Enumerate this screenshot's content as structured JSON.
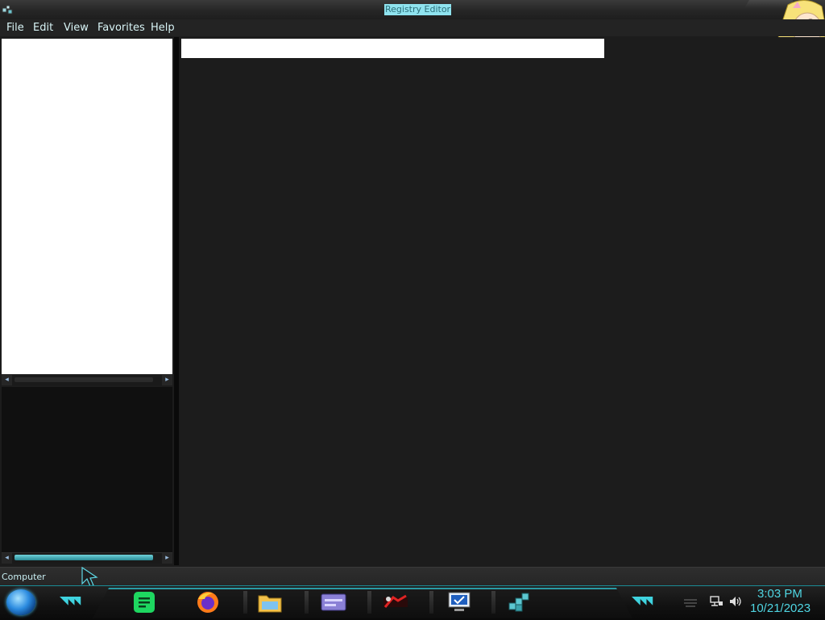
{
  "window": {
    "title": "Registry Editor"
  },
  "menu": {
    "items": [
      {
        "label": "File"
      },
      {
        "label": "Edit"
      },
      {
        "label": "View"
      },
      {
        "label": "Favorites"
      },
      {
        "label": "Help"
      }
    ]
  },
  "statusbar": {
    "text": "Computer"
  },
  "taskbar": {
    "apps": [
      {
        "name": "notes-app-icon"
      },
      {
        "name": "firefox-icon"
      },
      {
        "name": "file-explorer-icon"
      },
      {
        "name": "control-panel-icon"
      },
      {
        "name": "media-app-icon"
      },
      {
        "name": "remote-desktop-icon"
      },
      {
        "name": "registry-editor-icon"
      }
    ],
    "tray": {
      "icons": [
        "network-icon",
        "volume-icon"
      ],
      "time": "3:03 PM",
      "date": "10/21/2023"
    }
  },
  "colors": {
    "accent": "#4fd6e3",
    "title_highlight": "#8fe3ef",
    "background": "#1c1c1c"
  }
}
